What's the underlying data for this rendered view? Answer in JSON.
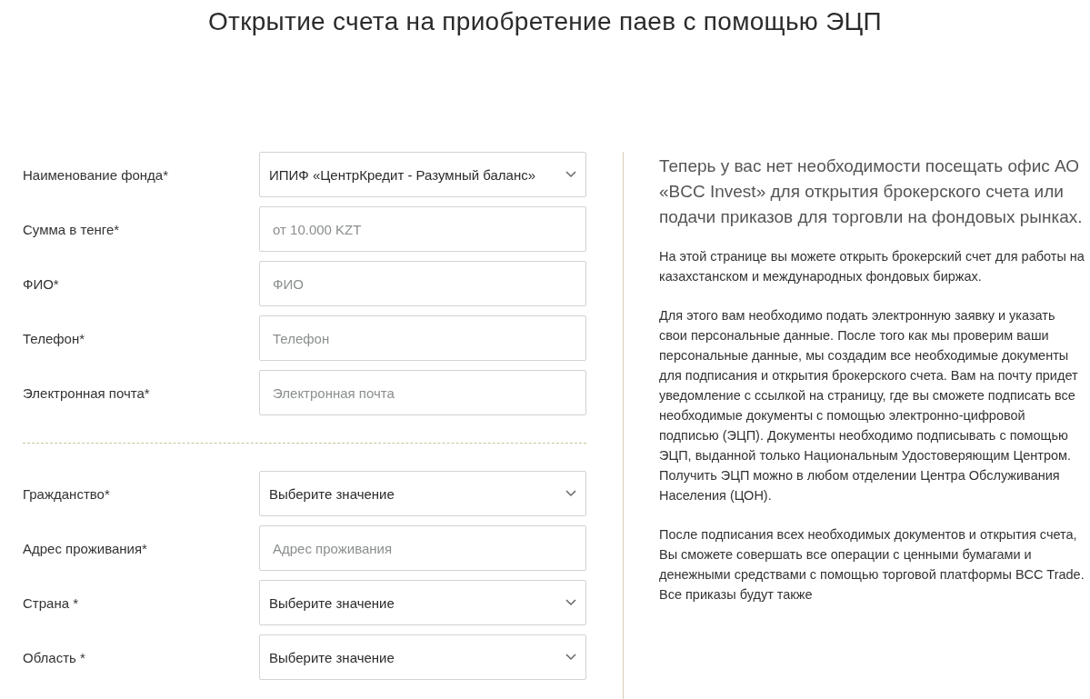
{
  "title": "Открытие счета на приобретение паев с помощью ЭЦП",
  "form": {
    "groups": [
      {
        "fields": [
          {
            "label": "Наименование фонда*",
            "kind": "select",
            "value": "ИПИФ «ЦентрКредит - Разумный баланс»"
          },
          {
            "label": "Сумма в тенге*",
            "kind": "input",
            "placeholder": "от 10.000 KZT"
          },
          {
            "label": "ФИО*",
            "kind": "input",
            "placeholder": "ФИО"
          },
          {
            "label": "Телефон*",
            "kind": "input",
            "placeholder": "Телефон"
          },
          {
            "label": "Электронная почта*",
            "kind": "input",
            "placeholder": "Электронная почта"
          }
        ]
      },
      {
        "fields": [
          {
            "label": "Гражданство*",
            "kind": "select",
            "value": "Выберите значение"
          },
          {
            "label": "Адрес проживания*",
            "kind": "input",
            "placeholder": "Адрес проживания"
          },
          {
            "label": "Страна *",
            "kind": "select",
            "value": "Выберите значение"
          },
          {
            "label": "Область *",
            "kind": "select",
            "value": "Выберите значение"
          }
        ]
      }
    ]
  },
  "info": {
    "lead": "Теперь у вас нет необходимости посещать офис АО «BCC Invest» для открытия брокерского счета или подачи приказов для торговли на фондовых рынках.",
    "paragraphs": [
      "На этой странице вы можете открыть брокерский счет для работы на казахстанском и международных фондовых биржах.",
      "Для этого вам необходимо подать электронную заявку и указать свои персональные данные. После того как мы проверим ваши персональные данные, мы создадим все необходимые документы для подписания и открытия брокерского счета. Вам на почту придет уведомление с ссылкой на страницу, где вы сможете подписать все необходимые документы с помощью электронно-цифровой подписью (ЭЦП). Документы необходимо подписывать с помощью ЭЦП, выданной только Национальным Удостоверяющим Центром. Получить ЭЦП можно в любом отделении Центра Обслуживания Населения (ЦОН).",
      "После подписания всех необходимых документов и открытия счета, Вы сможете совершать все операции с ценными бумагами и денежными средствами с помощью торговой платформы BCC Trade. Все приказы будут также"
    ]
  }
}
